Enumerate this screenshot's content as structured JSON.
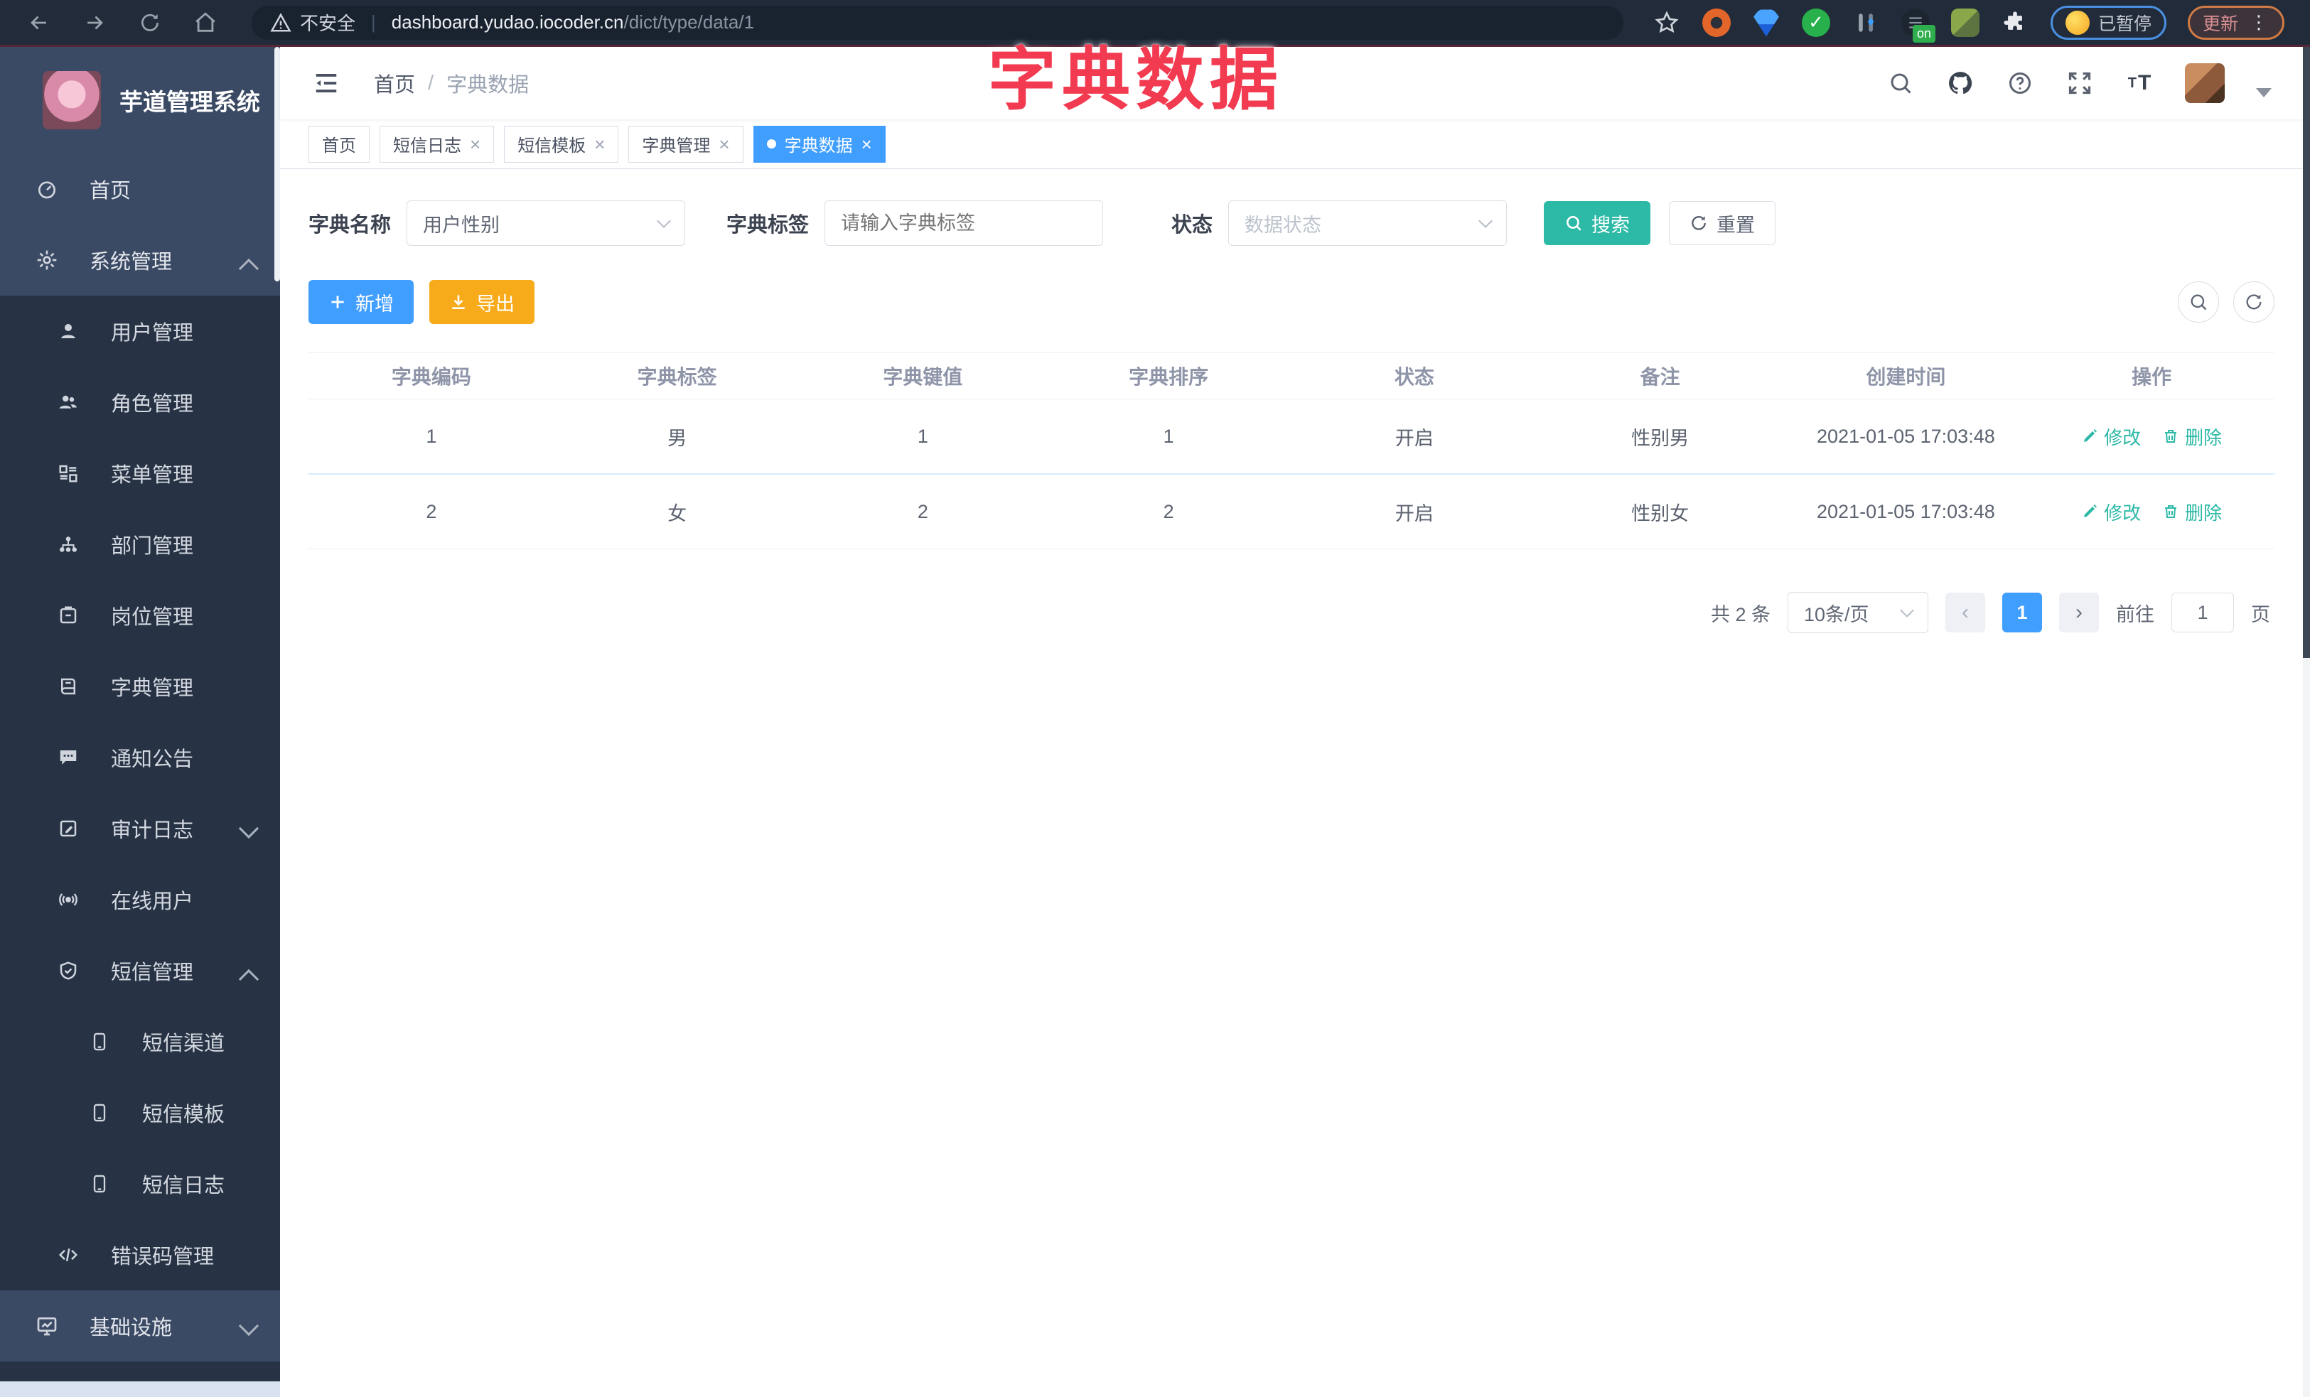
{
  "colors": {
    "primary_blue": "#409eff",
    "teal": "#2cb9a6",
    "warning_orange": "#f7ab1b",
    "annotation_red": "#f23a50",
    "sidebar_dark": "#273345",
    "sidebar_light": "#3b4a64",
    "browser_bar": "#212b39"
  },
  "browser": {
    "security_label": "不安全",
    "url_host": "dashboard.yudao.iocoder.cn",
    "url_path": "/dict/type/data/1",
    "paused_chip": "已暂停",
    "update_chip": "更新",
    "menu_dots": "⋮",
    "on_badge": "on"
  },
  "annotation": {
    "title": "字典数据"
  },
  "logo": {
    "title": "芋道管理系统"
  },
  "sidebar": {
    "items": [
      {
        "label": "首页"
      },
      {
        "label": "系统管理"
      },
      {
        "label": "用户管理"
      },
      {
        "label": "角色管理"
      },
      {
        "label": "菜单管理"
      },
      {
        "label": "部门管理"
      },
      {
        "label": "岗位管理"
      },
      {
        "label": "字典管理"
      },
      {
        "label": "通知公告"
      },
      {
        "label": "审计日志"
      },
      {
        "label": "在线用户"
      },
      {
        "label": "短信管理"
      },
      {
        "label": "短信渠道"
      },
      {
        "label": "短信模板"
      },
      {
        "label": "短信日志"
      },
      {
        "label": "错误码管理"
      },
      {
        "label": "基础设施"
      }
    ]
  },
  "breadcrumb": {
    "home": "首页",
    "separator": "/",
    "current": "字典数据"
  },
  "tabs": [
    {
      "label": "首页"
    },
    {
      "label": "短信日志"
    },
    {
      "label": "短信模板"
    },
    {
      "label": "字典管理"
    },
    {
      "label": "字典数据"
    }
  ],
  "filters": {
    "name_label": "字典名称",
    "name_value": "用户性别",
    "tag_label": "字典标签",
    "tag_placeholder": "请输入字典标签",
    "status_label": "状态",
    "status_placeholder": "数据状态",
    "search_label": "搜索",
    "reset_label": "重置"
  },
  "toolbar": {
    "add_label": "新增",
    "export_label": "导出"
  },
  "table": {
    "headers": [
      "字典编码",
      "字典标签",
      "字典键值",
      "字典排序",
      "状态",
      "备注",
      "创建时间",
      "操作"
    ],
    "actions": {
      "edit": "修改",
      "delete": "删除"
    },
    "rows": [
      {
        "code": "1",
        "label": "男",
        "value": "1",
        "sort": "1",
        "status": "开启",
        "remark": "性别男",
        "created": "2021-01-05 17:03:48"
      },
      {
        "code": "2",
        "label": "女",
        "value": "2",
        "sort": "2",
        "status": "开启",
        "remark": "性别女",
        "created": "2021-01-05 17:03:48"
      }
    ]
  },
  "pagination": {
    "total": "共 2 条",
    "page_size": "10条/页",
    "current_page": "1",
    "goto_label": "前往",
    "goto_value": "1",
    "page_unit": "页"
  }
}
